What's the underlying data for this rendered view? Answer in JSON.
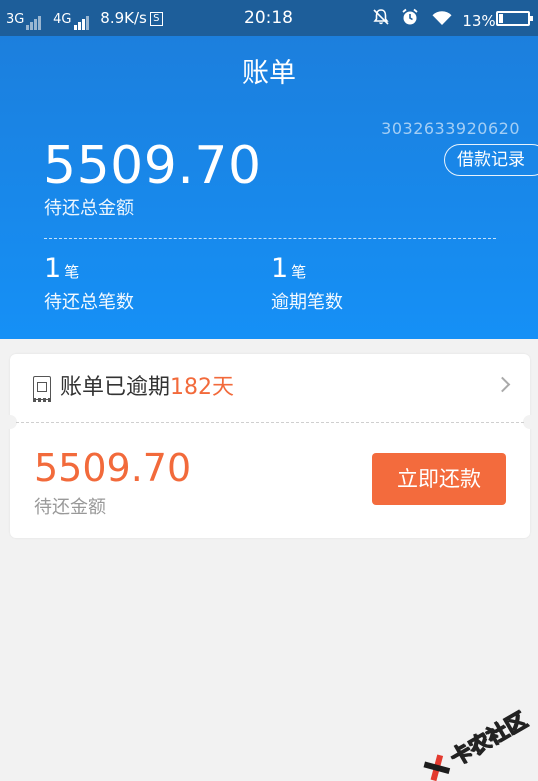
{
  "status_bar": {
    "net1": "3G",
    "net2": "4G",
    "speed": "8.9K/s",
    "s_badge": "S",
    "time": "20:18",
    "battery_pct": "13%",
    "battery_level": 0.13
  },
  "header": {
    "title": "账单",
    "account_id": "3032633920620",
    "loan_record_label": "借款记录",
    "total_amount": "5509.70",
    "total_label": "待还总金额",
    "stats": [
      {
        "value": "1",
        "unit": "笔",
        "label": "待还总笔数"
      },
      {
        "value": "1",
        "unit": "笔",
        "label": "逾期笔数"
      }
    ]
  },
  "bill_card": {
    "overdue_prefix": "账单已逾期",
    "overdue_days": "182天",
    "due_amount": "5509.70",
    "due_label": "待还金额",
    "repay_label": "立即还款"
  },
  "watermark": {
    "text": "卡农社区"
  },
  "colors": {
    "header_top": "#1c7fdd",
    "header_bottom": "#1590f6",
    "accent_orange": "#f26a3b",
    "background": "#f2f2f2"
  }
}
